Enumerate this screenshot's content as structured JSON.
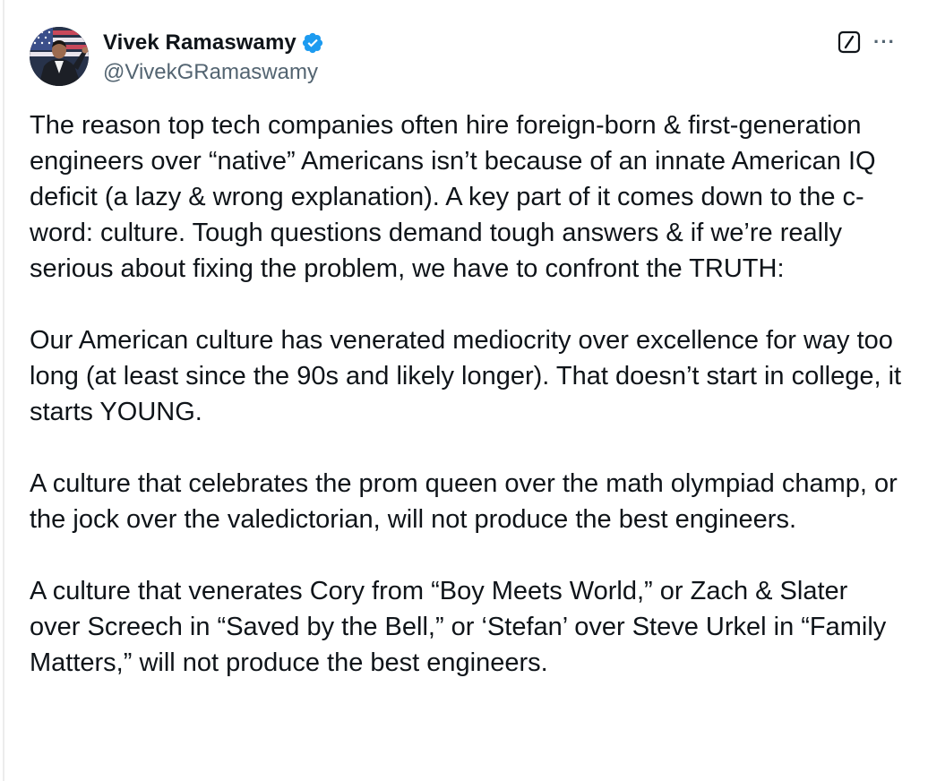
{
  "author": {
    "display_name": "Vivek Ramaswamy",
    "handle": "@VivekGRamaswamy",
    "verified": true,
    "verified_color": "#1d9bf0"
  },
  "icons": {
    "avatar": "profile-photo",
    "verified": "verified-badge-icon",
    "grok": "grok-icon",
    "more": "more-icon"
  },
  "more_label": "···",
  "tweet": {
    "paragraphs": [
      "The reason top tech companies often hire foreign-born & first-generation engineers over “native” Americans isn’t because of an innate American IQ deficit (a lazy & wrong explanation). A key part of it comes down to the c-word: culture. Tough questions demand tough answers & if we’re really serious about fixing the problem, we have to confront the TRUTH:",
      "Our American culture has venerated mediocrity over excellence for way too long (at least since the 90s and likely longer). That doesn’t start in college, it starts YOUNG.",
      "A culture that celebrates the prom queen over the math olympiad champ, or the jock over the valedictorian, will not produce the best engineers.",
      "A culture that venerates Cory from “Boy Meets World,” or Zach & Slater over Screech in “Saved by the Bell,” or ‘Stefan’ over Steve Urkel in “Family Matters,” will not produce the best engineers."
    ]
  },
  "colors": {
    "text": "#0f1419",
    "secondary": "#536471",
    "accent": "#1d9bf0"
  }
}
